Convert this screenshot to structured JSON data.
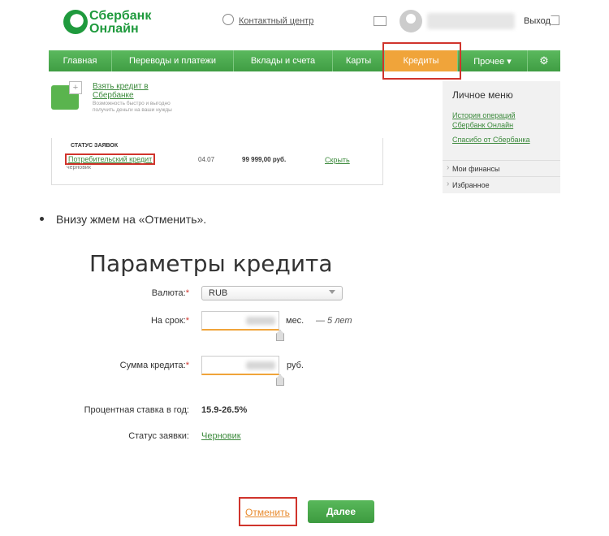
{
  "header": {
    "logo_line1": "Сбербанк",
    "logo_line2": "Онлайн",
    "contact_center": "Контактный центр",
    "logout": "Выход"
  },
  "nav": {
    "items": [
      {
        "label": "Главная"
      },
      {
        "label": "Переводы и платежи"
      },
      {
        "label": "Вклады и счета"
      },
      {
        "label": "Карты"
      },
      {
        "label": "Кредиты",
        "active": true
      },
      {
        "label": "Прочее ▾"
      }
    ],
    "settings_icon": "gear-icon"
  },
  "credit_block": {
    "take_credit_line1": "Взять кредит в",
    "take_credit_line2": "Сбербанке",
    "take_desc": "Возможность быстро и выгодно получить деньги на ваши нужды"
  },
  "status_panel": {
    "title": "СТАТУС ЗАЯВОК",
    "loan_name": "Потребительский кредит",
    "loan_status": "черновик",
    "date": "04.07",
    "amount": "99 999,00 руб.",
    "hide": "Скрыть"
  },
  "personal_menu": {
    "title": "Личное меню",
    "link1_line1": "История операций",
    "link1_line2": "Сбербанк Онлайн",
    "link2": "Спасибо от Сбербанка",
    "items": [
      "Мои финансы",
      "Избранное"
    ]
  },
  "instruction": "Внизу жмем на «Отменить».",
  "params": {
    "title": "Параметры кредита",
    "currency_label": "Валюта:",
    "currency_value": "RUB",
    "term_label": "На срок:",
    "term_unit": "мес.",
    "term_hint": "— 5 лет",
    "amount_label": "Сумма кредита:",
    "amount_unit": "руб.",
    "rate_label": "Процентная ставка в год:",
    "rate_value": "15.9-26.5%",
    "status_label": "Статус заявки:",
    "status_value": "Черновик"
  },
  "actions": {
    "cancel": "Отменить",
    "next": "Далее"
  },
  "colors": {
    "brand_green": "#3f9d43",
    "active_orange": "#f0a43a",
    "highlight_red": "#d0342c"
  }
}
